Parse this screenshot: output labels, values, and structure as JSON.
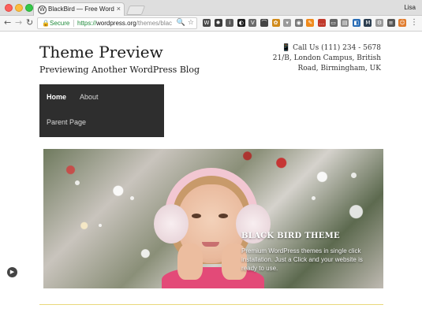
{
  "browser": {
    "tab_title": "BlackBird — Free WordPress T",
    "tab_favicon": "W",
    "tab_close": "×",
    "user_name": "Lisa",
    "nav": {
      "back": "←",
      "forward": "→",
      "reload": "↻"
    },
    "omnibox": {
      "lock_icon": "🔒",
      "secure_label": "Secure",
      "url_scheme": "https://",
      "url_host": "wordpress.org",
      "url_path": "/themes/black...",
      "zoom_icon": "🔍",
      "star_icon": "☆"
    },
    "extensions": [
      {
        "name": "wordpress-ext-icon",
        "glyph": "W",
        "color": "#4b4b4b"
      },
      {
        "name": "gear-ext-icon",
        "glyph": "✹",
        "color": "#3b3b3b"
      },
      {
        "name": "info-ext-icon",
        "glyph": "i",
        "color": "#5a5a5a"
      },
      {
        "name": "dark-ext-icon",
        "glyph": "◐",
        "color": "#1e1e1e"
      },
      {
        "name": "vault-ext-icon",
        "glyph": "V",
        "color": "#6b6b6b"
      },
      {
        "name": "link-ext-icon",
        "glyph": "⌒",
        "color": "#444"
      },
      {
        "name": "honey-ext-icon",
        "glyph": "✿",
        "color": "#d08a1a"
      },
      {
        "name": "pocket-ext-icon",
        "glyph": "▾",
        "color": "#9a9a9a"
      },
      {
        "name": "screenshot-ext-icon",
        "glyph": "◉",
        "color": "#777"
      },
      {
        "name": "orange-ext-icon",
        "glyph": "✎",
        "color": "#f08a1c"
      },
      {
        "name": "lastpass-ext-icon",
        "glyph": "…",
        "color": "#c0392b"
      },
      {
        "name": "cast-ext-icon",
        "glyph": "▭",
        "color": "#666"
      },
      {
        "name": "docs-ext-icon",
        "glyph": "▤",
        "color": "#888"
      },
      {
        "name": "blue-ext-icon",
        "glyph": "◧",
        "color": "#2a6db5"
      },
      {
        "name": "m-ext-icon",
        "glyph": "M",
        "color": "#2c3e50"
      },
      {
        "name": "settings-ext-icon",
        "glyph": "⚙",
        "color": "#999"
      },
      {
        "name": "buffer-ext-icon",
        "glyph": "≡",
        "color": "#555"
      },
      {
        "name": "face-ext-icon",
        "glyph": "☺",
        "color": "#e07b2c"
      }
    ],
    "menu_icon": "⋮"
  },
  "site": {
    "title": "Theme Preview",
    "description": "Previewing Another WordPress Blog",
    "phone_icon": "📱",
    "phone": "Call Us (111) 234 - 5678",
    "address_line1": "21/B, London Campus, British",
    "address_line2": "Road, Birmingham, UK"
  },
  "menu": {
    "home": "Home",
    "about": "About",
    "parent": "Parent Page"
  },
  "hero": {
    "title": "BLACK BIRD THEME",
    "text": "Premium WordPress themes in single click installation. Just a Click and your website is ready to use."
  },
  "player_icon": "▶"
}
